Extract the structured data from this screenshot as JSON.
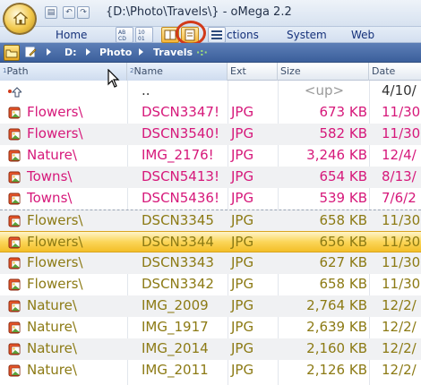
{
  "window": {
    "title": "{D:\\Photo\\Travels\\} - oMega 2.2",
    "qat_label": "▤",
    "undo_label": "↶",
    "redo_label": "↷"
  },
  "ribbon": {
    "tabs": {
      "home": "Home",
      "actions": "ctions",
      "system": "System",
      "web": "Web"
    }
  },
  "breadcrumb": {
    "items": [
      "D:",
      "Photo",
      "Travels"
    ],
    "extra": "·:·"
  },
  "columns": {
    "path": {
      "label": "Path",
      "sort": "1"
    },
    "name": {
      "label": "Name",
      "sort": "2"
    },
    "ext": "Ext",
    "size": "Size",
    "date": "Date"
  },
  "up_row": {
    "name": "..",
    "size": "<up>",
    "date": "4/10/"
  },
  "rows": [
    {
      "path": "Flowers\\",
      "name": "DSCN3347!",
      "ext": "JPG",
      "size": "673 KB",
      "date": "11/30",
      "color": "#d6187a"
    },
    {
      "path": "Flowers\\",
      "name": "DSCN3540!",
      "ext": "JPG",
      "size": "582 KB",
      "date": "11/30",
      "color": "#d6187a"
    },
    {
      "path": "Nature\\",
      "name": "IMG_2176!",
      "ext": "JPG",
      "size": "3,246 KB",
      "date": "12/4/",
      "color": "#d6187a"
    },
    {
      "path": "Towns\\",
      "name": "DSCN5413!",
      "ext": "JPG",
      "size": "654 KB",
      "date": "8/13/",
      "color": "#d6187a"
    },
    {
      "path": "Towns\\",
      "name": "DSCN5436!",
      "ext": "JPG",
      "size": "539 KB",
      "date": "7/6/2",
      "color": "#d6187a"
    },
    {
      "path": "Flowers\\",
      "name": "DSCN3345",
      "ext": "JPG",
      "size": "658 KB",
      "date": "11/30",
      "color": "#8c7a14"
    },
    {
      "path": "Flowers\\",
      "name": "DSCN3344",
      "ext": "JPG",
      "size": "656 KB",
      "date": "11/30",
      "color": "#8c7a14"
    },
    {
      "path": "Flowers\\",
      "name": "DSCN3343",
      "ext": "JPG",
      "size": "627 KB",
      "date": "11/30",
      "color": "#8c7a14"
    },
    {
      "path": "Flowers\\",
      "name": "DSCN3342",
      "ext": "JPG",
      "size": "658 KB",
      "date": "11/30",
      "color": "#8c7a14"
    },
    {
      "path": "Nature\\",
      "name": "IMG_2009",
      "ext": "JPG",
      "size": "2,764 KB",
      "date": "12/2/",
      "color": "#8c7a14"
    },
    {
      "path": "Nature\\",
      "name": "IMG_1917",
      "ext": "JPG",
      "size": "2,639 KB",
      "date": "12/2/",
      "color": "#8c7a14"
    },
    {
      "path": "Nature\\",
      "name": "IMG_2014",
      "ext": "JPG",
      "size": "2,160 KB",
      "date": "12/2/",
      "color": "#8c7a14"
    },
    {
      "path": "Nature\\",
      "name": "IMG_2011",
      "ext": "JPG",
      "size": "2,126 KB",
      "date": "12/2/",
      "color": "#8c7a14"
    }
  ],
  "colors": {
    "accent_marked": "#d6187a",
    "accent_olive": "#8c7a14",
    "selection": "#fbd65a",
    "up_text": "#9a9a9a"
  }
}
